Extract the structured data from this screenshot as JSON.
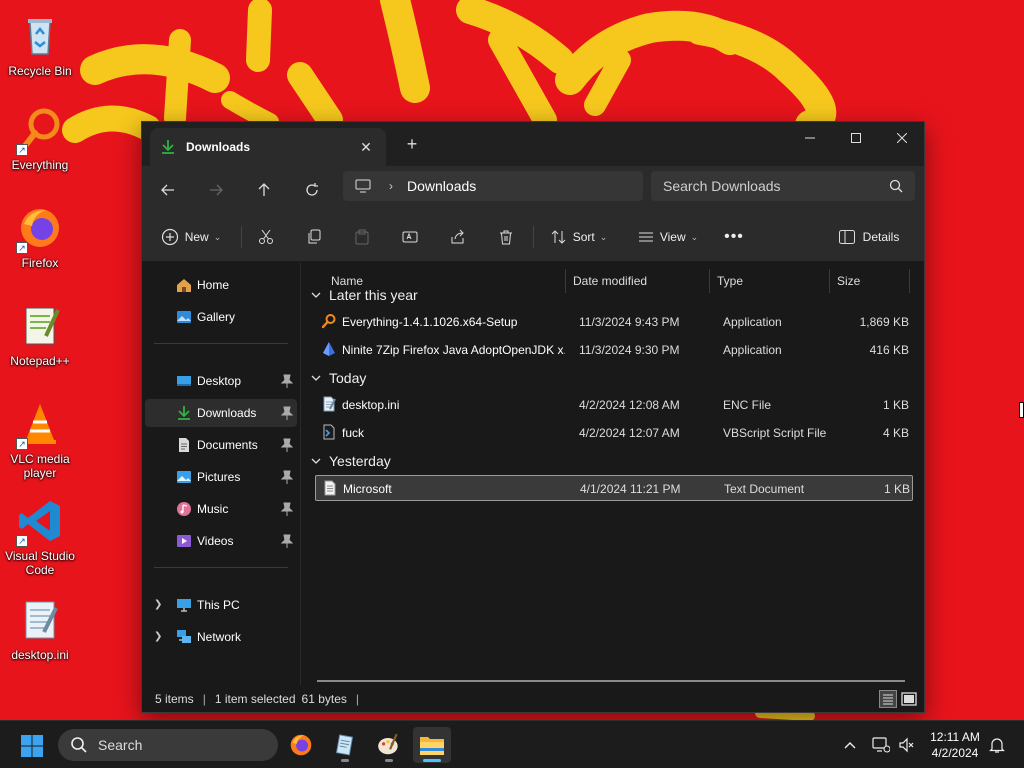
{
  "desktop": {
    "icons": [
      {
        "label": "Recycle Bin",
        "icon": "recycle-bin-icon"
      },
      {
        "label": "Everything",
        "icon": "everything-icon"
      },
      {
        "label": "Firefox",
        "icon": "firefox-icon"
      },
      {
        "label": "Notepad++",
        "icon": "notepad-plus-plus-icon"
      },
      {
        "label": "VLC media player",
        "icon": "vlc-icon"
      },
      {
        "label": "Visual Studio Code",
        "icon": "vscode-icon"
      },
      {
        "label": "desktop.ini",
        "icon": "ini-file-icon"
      }
    ]
  },
  "window": {
    "tab_title": "Downloads",
    "address": {
      "crumb": "Downloads"
    },
    "search_placeholder": "Search Downloads",
    "toolbar": {
      "new_label": "New",
      "sort_label": "Sort",
      "view_label": "View",
      "details_label": "Details"
    },
    "sidebar": {
      "home": "Home",
      "gallery": "Gallery",
      "desktop": "Desktop",
      "downloads": "Downloads",
      "documents": "Documents",
      "pictures": "Pictures",
      "music": "Music",
      "videos": "Videos",
      "this_pc": "This PC",
      "network": "Network"
    },
    "columns": {
      "name": "Name",
      "date": "Date modified",
      "type": "Type",
      "size": "Size"
    },
    "groups": [
      {
        "label": "Later this year",
        "files": [
          {
            "name": "Everything-1.4.1.1026.x64-Setup",
            "date": "11/3/2024 9:43 PM",
            "type": "Application",
            "size": "1,869 KB",
            "icon": "everything-icon"
          },
          {
            "name": "Ninite 7Zip Firefox Java AdoptOpenJDK x...",
            "date": "11/3/2024 9:30 PM",
            "type": "Application",
            "size": "416 KB",
            "icon": "ninite-icon"
          }
        ]
      },
      {
        "label": "Today",
        "files": [
          {
            "name": "desktop.ini",
            "date": "4/2/2024 12:08 AM",
            "type": "ENC File",
            "size": "1 KB",
            "icon": "ini-file-icon"
          },
          {
            "name": "fuck",
            "date": "4/2/2024 12:07 AM",
            "type": "VBScript Script File",
            "size": "4 KB",
            "icon": "vbscript-file-icon"
          }
        ]
      },
      {
        "label": "Yesterday",
        "files": [
          {
            "name": "Microsoft",
            "date": "4/1/2024 11:21 PM",
            "type": "Text Document",
            "size": "1 KB",
            "icon": "text-file-icon"
          }
        ]
      }
    ],
    "status": {
      "items": "5 items",
      "selected": "1 item selected",
      "bytes": "61 bytes"
    }
  },
  "taskbar": {
    "search_label": "Search",
    "time": "12:11 AM",
    "date": "4/2/2024"
  },
  "colors": {
    "wallpaper_red": "#e8141c",
    "wallpaper_yellow": "#f7d21e",
    "explorer_bg": "#191919",
    "explorer_chrome": "#2b2b2b",
    "accent": "#4cc2ff",
    "downloads_green": "#2fb344"
  }
}
